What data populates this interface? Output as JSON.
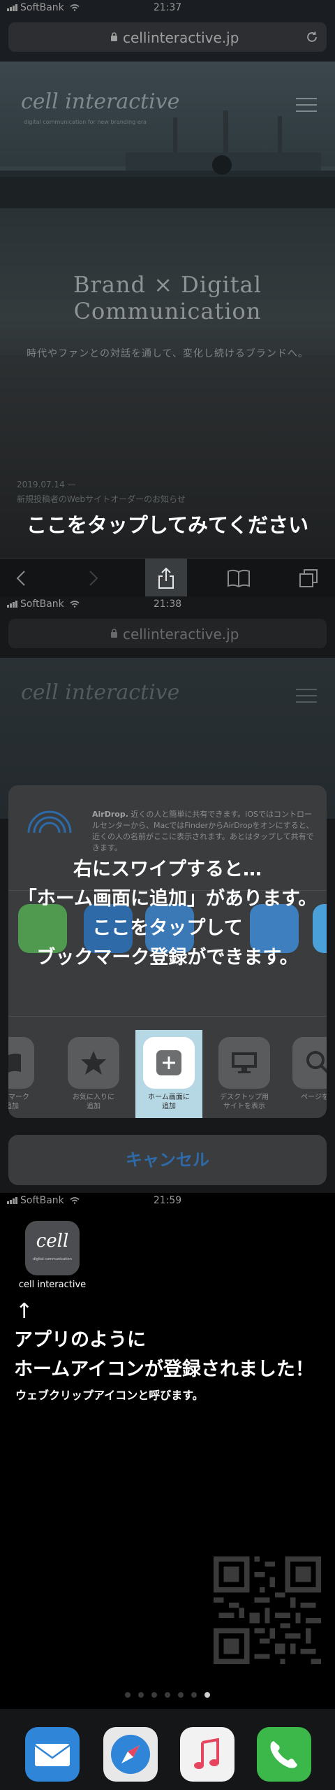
{
  "status_bar_1": {
    "carrier": "SoftBank",
    "time": "21:37"
  },
  "status_bar_2": {
    "carrier": "SoftBank",
    "time": "21:38"
  },
  "status_bar_3": {
    "carrier": "SoftBank",
    "time": "21:59"
  },
  "browser": {
    "url": "cellinteractive.jp"
  },
  "site": {
    "logo": "cell interactive",
    "logo_sub": "digital communication for new branding era",
    "headline_line1": "Brand × Digital",
    "headline_line2": "Communication",
    "tagline": "時代やファンとの対話を通して、変化し続けるブランドへ。",
    "news_date": "2019.07.14 —",
    "news_text": "新規投稿者のWebサイトオーダーのお知らせ"
  },
  "hints": {
    "tap_here": "ここをタップしてみてください",
    "swipe_line1": "右にスワイプすると…",
    "swipe_line2": "「ホーム画面に追加」があります。",
    "swipe_line3": "ここをタップして",
    "swipe_line4": "ブックマーク登録ができます。",
    "result_line1": "アプリのように",
    "result_line2": "ホームアイコンが登録されました！",
    "result_sub": "ウェブクリップアイコンと呼びます。"
  },
  "share_sheet": {
    "airdrop_title": "AirDrop.",
    "airdrop_text": "近くの人と簡単に共有できます。iOSではコントロールセンターから、MacではFinderからAirDropをオンにすると、近くの人の名前がここに表示されます。あとはタップして共有できます。",
    "actions": [
      {
        "label": "ブックマーク\nを追加",
        "icon": "book-icon"
      },
      {
        "label": "お気に入りに\n追加",
        "icon": "star-icon"
      },
      {
        "label": "ホーム画面に\n追加",
        "icon": "plus-square-icon"
      },
      {
        "label": "デスクトップ用\nサイトを表示",
        "icon": "desktop-icon"
      },
      {
        "label": "ページを検",
        "icon": "search-icon"
      }
    ],
    "cancel": "キャンセル"
  },
  "home_screen": {
    "webclip_label": "cell interactive",
    "webclip_icon_text": "cell",
    "webclip_icon_sub": "digital communication",
    "arrow": "↑",
    "page_dots": 7,
    "active_dot": 6
  },
  "colors": {
    "accent_blue": "#2f6aa8",
    "highlight": "#b6d7e4",
    "mail": "#2f86d8",
    "phone": "#3cb84a",
    "music": "#e6455f"
  }
}
